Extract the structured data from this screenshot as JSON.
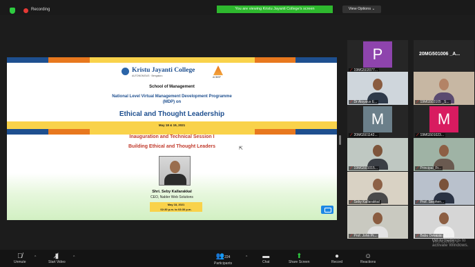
{
  "top_bar": {
    "recording_label": "Recording",
    "share_banner": "You are viewing Kristu Jayanti College's screen",
    "view_options": "View Options ⌄"
  },
  "slide": {
    "college": "Kristu Jayanti College",
    "college_sub": "AUTONOMOUS · Bengaluru",
    "accreditation": "ACBSP",
    "school": "School of Management",
    "programme_line1": "National Level Virtual Management Development Programme",
    "programme_line2": "(MDP) on",
    "topic": "Ethical and Thought Leadership",
    "dates": "May 18 & 19, 2021",
    "session_line1": "Inauguration and Technical Session I",
    "session_line2": "Building Ethical and Thought Leaders",
    "speaker_name": "Shri. Seby Kallarakkal",
    "speaker_role": "CEO, Nabler Web Solutions",
    "time_line1": "May 18, 2021",
    "time_line2": "02:30 p.m. to 03:30 p.m.",
    "stripe_colors": [
      "#1e4f8f",
      "#e8781e",
      "#f9d24a",
      "#f9d24a",
      "#f9d24a",
      "#f9d24a",
      "#e8781e",
      "#1e4f8f"
    ]
  },
  "participants": [
    {
      "label": "19MG502077...",
      "letter": "P",
      "color": "#8e44ad"
    },
    {
      "label": "",
      "name_only": "20MG501006 _A...",
      "letter": ""
    },
    {
      "label": "Dr Aloysius E...",
      "letter": ""
    },
    {
      "label": "19MG503105 _S...",
      "letter": ""
    },
    {
      "label": "20MG501142...",
      "letter": "M",
      "color": "#6b7f8a"
    },
    {
      "label": "19MG501023...",
      "letter": "M",
      "color": "#d81b60"
    },
    {
      "label": "19MG501015...",
      "letter": ""
    },
    {
      "label": "Principal_Fr...",
      "letter": ""
    },
    {
      "label": "Seby Kallarakkal",
      "letter": ""
    },
    {
      "label": "Prof. Stephen...",
      "letter": ""
    },
    {
      "label": "Prof. John Pr...",
      "letter": ""
    },
    {
      "label": "Babu Devasia",
      "letter": ""
    }
  ],
  "toolbar": {
    "unmute": "Unmute",
    "start_video": "Start Video",
    "participants": "Participants",
    "participant_count": "224",
    "chat": "Chat",
    "share_screen": "Share Screen",
    "record": "Record",
    "reactions": "Reactions"
  },
  "watermark": {
    "line1": "Activate Windows",
    "line2": "Go to Settings to activate Windows."
  }
}
